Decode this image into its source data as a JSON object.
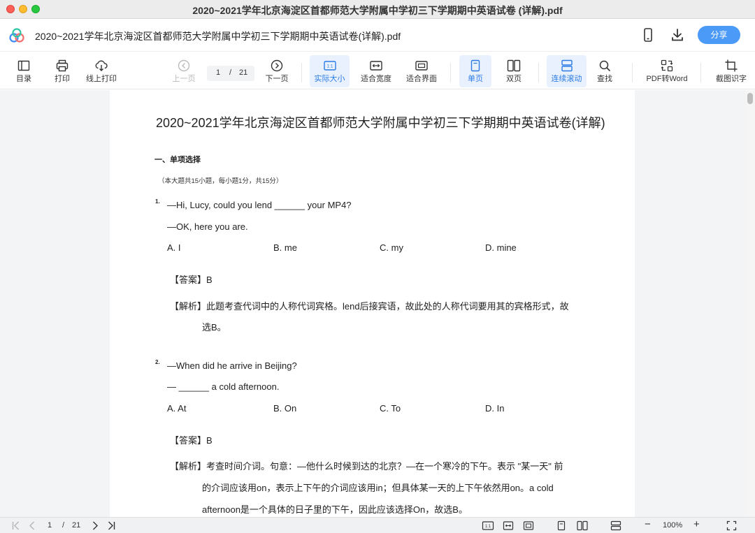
{
  "window": {
    "title": "2020~2021学年北京海淀区首都师范大学附属中学初三下学期期中英语试卷 (详解).pdf"
  },
  "header": {
    "doc_title": "2020~2021学年北京海淀区首都师范大学附属中学初三下学期期中英语试卷(详解).pdf",
    "share_label": "分享",
    "icons": [
      "app-logo-icon",
      "phone-icon",
      "download-icon"
    ]
  },
  "toolbar": {
    "items": [
      {
        "id": "toc",
        "label": "目录",
        "icon": "toc-icon"
      },
      {
        "id": "print",
        "label": "打印",
        "icon": "printer-icon"
      },
      {
        "id": "online_print",
        "label": "线上打印",
        "icon": "cloud-print-icon"
      },
      {
        "id": "prev",
        "label": "上一页",
        "icon": "chevron-left-icon",
        "state": "disabled"
      },
      {
        "id": "next",
        "label": "下一页",
        "icon": "chevron-right-icon"
      },
      {
        "id": "actual_size",
        "label": "实际大小",
        "icon": "actual-size-icon",
        "state": "active"
      },
      {
        "id": "fit_width",
        "label": "适合宽度",
        "icon": "fit-width-icon"
      },
      {
        "id": "fit_page",
        "label": "适合界面",
        "icon": "fit-page-icon"
      },
      {
        "id": "single",
        "label": "单页",
        "icon": "single-page-icon",
        "state": "active"
      },
      {
        "id": "double",
        "label": "双页",
        "icon": "double-page-icon"
      },
      {
        "id": "continuous",
        "label": "连续滚动",
        "icon": "continuous-scroll-icon",
        "state": "active"
      },
      {
        "id": "find",
        "label": "查找",
        "icon": "search-icon"
      },
      {
        "id": "pdf2word",
        "label": "PDF转Word",
        "icon": "convert-icon"
      },
      {
        "id": "ocr",
        "label": "截图识字",
        "icon": "crop-icon"
      }
    ],
    "page_current": "1",
    "page_sep": "/",
    "page_total": "21",
    "actual_size_glyph": "1:1"
  },
  "document": {
    "heading": "2020~2021学年北京海淀区首都师范大学附属中学初三下学期期中英语试卷(详解)",
    "section_title": "一、单项选择",
    "section_note": "（本大题共15小题，每小题1分，共15分）",
    "questions": [
      {
        "number": "1.",
        "lines": [
          "—Hi, Lucy, could you lend ______ your MP4?",
          "—OK, here you are."
        ],
        "options": [
          "A. I",
          "B. me",
          "C. my",
          "D. mine"
        ],
        "answer_label": "【答案】",
        "answer": "B",
        "analysis_label": "【解析】",
        "analysis_lines": [
          "此题考查代词中的人称代词宾格。lend后接宾语，故此处的人称代词要用其的宾格形式，故",
          "选B。"
        ]
      },
      {
        "number": "2.",
        "lines": [
          "—When did he arrive in Beijing?",
          "— ______ a cold afternoon."
        ],
        "options": [
          "A. At",
          "B. On",
          "C. To",
          "D. In"
        ],
        "answer_label": "【答案】",
        "answer": "B",
        "analysis_label": "【解析】",
        "analysis_lines": [
          "考查时间介词。句意：—他什么时候到达的北京？—在一个寒冷的下午。表示 \"某一天\" 前",
          "的介词应该用on，表示上下午的介词应该用in；但具体某一天的上下午依然用on。a cold",
          "afternoon是一个具体的日子里的下午，因此应该选择On，故选B。"
        ]
      }
    ]
  },
  "bottombar": {
    "page_current": "1",
    "page_sep": "/",
    "page_total": "21",
    "zoom": "100%",
    "actual_size_glyph": "1:1",
    "zoom_out": "−",
    "zoom_in": "+"
  },
  "colors": {
    "accent": "#4b9af7",
    "active_bg": "#e8f1fd",
    "active_text": "#2c7be5"
  }
}
